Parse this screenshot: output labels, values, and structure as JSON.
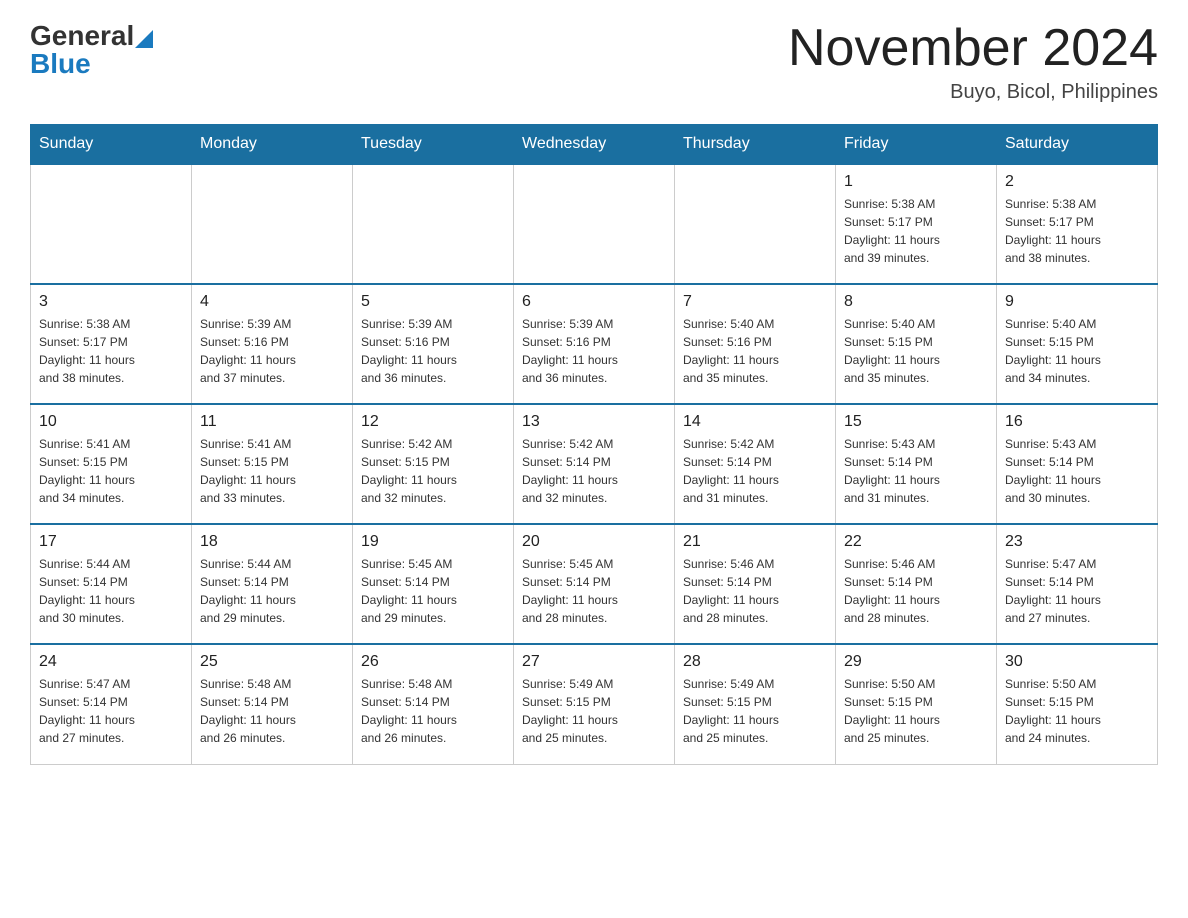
{
  "header": {
    "logo": {
      "general": "General",
      "blue": "Blue"
    },
    "title": "November 2024",
    "location": "Buyo, Bicol, Philippines"
  },
  "days_of_week": [
    "Sunday",
    "Monday",
    "Tuesday",
    "Wednesday",
    "Thursday",
    "Friday",
    "Saturday"
  ],
  "weeks": [
    [
      {
        "day": "",
        "info": ""
      },
      {
        "day": "",
        "info": ""
      },
      {
        "day": "",
        "info": ""
      },
      {
        "day": "",
        "info": ""
      },
      {
        "day": "",
        "info": ""
      },
      {
        "day": "1",
        "info": "Sunrise: 5:38 AM\nSunset: 5:17 PM\nDaylight: 11 hours\nand 39 minutes."
      },
      {
        "day": "2",
        "info": "Sunrise: 5:38 AM\nSunset: 5:17 PM\nDaylight: 11 hours\nand 38 minutes."
      }
    ],
    [
      {
        "day": "3",
        "info": "Sunrise: 5:38 AM\nSunset: 5:17 PM\nDaylight: 11 hours\nand 38 minutes."
      },
      {
        "day": "4",
        "info": "Sunrise: 5:39 AM\nSunset: 5:16 PM\nDaylight: 11 hours\nand 37 minutes."
      },
      {
        "day": "5",
        "info": "Sunrise: 5:39 AM\nSunset: 5:16 PM\nDaylight: 11 hours\nand 36 minutes."
      },
      {
        "day": "6",
        "info": "Sunrise: 5:39 AM\nSunset: 5:16 PM\nDaylight: 11 hours\nand 36 minutes."
      },
      {
        "day": "7",
        "info": "Sunrise: 5:40 AM\nSunset: 5:16 PM\nDaylight: 11 hours\nand 35 minutes."
      },
      {
        "day": "8",
        "info": "Sunrise: 5:40 AM\nSunset: 5:15 PM\nDaylight: 11 hours\nand 35 minutes."
      },
      {
        "day": "9",
        "info": "Sunrise: 5:40 AM\nSunset: 5:15 PM\nDaylight: 11 hours\nand 34 minutes."
      }
    ],
    [
      {
        "day": "10",
        "info": "Sunrise: 5:41 AM\nSunset: 5:15 PM\nDaylight: 11 hours\nand 34 minutes."
      },
      {
        "day": "11",
        "info": "Sunrise: 5:41 AM\nSunset: 5:15 PM\nDaylight: 11 hours\nand 33 minutes."
      },
      {
        "day": "12",
        "info": "Sunrise: 5:42 AM\nSunset: 5:15 PM\nDaylight: 11 hours\nand 32 minutes."
      },
      {
        "day": "13",
        "info": "Sunrise: 5:42 AM\nSunset: 5:14 PM\nDaylight: 11 hours\nand 32 minutes."
      },
      {
        "day": "14",
        "info": "Sunrise: 5:42 AM\nSunset: 5:14 PM\nDaylight: 11 hours\nand 31 minutes."
      },
      {
        "day": "15",
        "info": "Sunrise: 5:43 AM\nSunset: 5:14 PM\nDaylight: 11 hours\nand 31 minutes."
      },
      {
        "day": "16",
        "info": "Sunrise: 5:43 AM\nSunset: 5:14 PM\nDaylight: 11 hours\nand 30 minutes."
      }
    ],
    [
      {
        "day": "17",
        "info": "Sunrise: 5:44 AM\nSunset: 5:14 PM\nDaylight: 11 hours\nand 30 minutes."
      },
      {
        "day": "18",
        "info": "Sunrise: 5:44 AM\nSunset: 5:14 PM\nDaylight: 11 hours\nand 29 minutes."
      },
      {
        "day": "19",
        "info": "Sunrise: 5:45 AM\nSunset: 5:14 PM\nDaylight: 11 hours\nand 29 minutes."
      },
      {
        "day": "20",
        "info": "Sunrise: 5:45 AM\nSunset: 5:14 PM\nDaylight: 11 hours\nand 28 minutes."
      },
      {
        "day": "21",
        "info": "Sunrise: 5:46 AM\nSunset: 5:14 PM\nDaylight: 11 hours\nand 28 minutes."
      },
      {
        "day": "22",
        "info": "Sunrise: 5:46 AM\nSunset: 5:14 PM\nDaylight: 11 hours\nand 28 minutes."
      },
      {
        "day": "23",
        "info": "Sunrise: 5:47 AM\nSunset: 5:14 PM\nDaylight: 11 hours\nand 27 minutes."
      }
    ],
    [
      {
        "day": "24",
        "info": "Sunrise: 5:47 AM\nSunset: 5:14 PM\nDaylight: 11 hours\nand 27 minutes."
      },
      {
        "day": "25",
        "info": "Sunrise: 5:48 AM\nSunset: 5:14 PM\nDaylight: 11 hours\nand 26 minutes."
      },
      {
        "day": "26",
        "info": "Sunrise: 5:48 AM\nSunset: 5:14 PM\nDaylight: 11 hours\nand 26 minutes."
      },
      {
        "day": "27",
        "info": "Sunrise: 5:49 AM\nSunset: 5:15 PM\nDaylight: 11 hours\nand 25 minutes."
      },
      {
        "day": "28",
        "info": "Sunrise: 5:49 AM\nSunset: 5:15 PM\nDaylight: 11 hours\nand 25 minutes."
      },
      {
        "day": "29",
        "info": "Sunrise: 5:50 AM\nSunset: 5:15 PM\nDaylight: 11 hours\nand 25 minutes."
      },
      {
        "day": "30",
        "info": "Sunrise: 5:50 AM\nSunset: 5:15 PM\nDaylight: 11 hours\nand 24 minutes."
      }
    ]
  ]
}
